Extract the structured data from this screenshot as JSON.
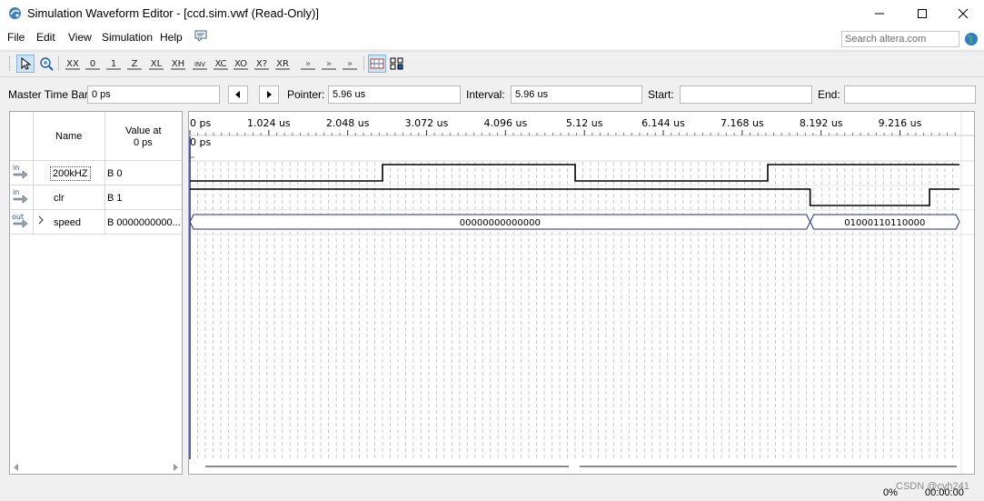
{
  "window": {
    "title": "Simulation Waveform Editor - [ccd.sim.vwf (Read-Only)]"
  },
  "menu": [
    "File",
    "Edit",
    "View",
    "Simulation",
    "Help"
  ],
  "search": {
    "placeholder": "Search altera.com"
  },
  "toolbar_icons": [
    "selection-pointer",
    "zoom",
    "uninitialized",
    "forcing-low",
    "forcing-high",
    "high-impedance",
    "weak-low",
    "weak-high",
    "invert",
    "count-value",
    "clock",
    "arbitrary-value",
    "random-value",
    "snap-to-grid",
    "overwrite-clock",
    "overwrite-value",
    "grid",
    "snap"
  ],
  "timebar": {
    "master_time_bar_label": "Master Time Bar:",
    "master_time_bar_value": "0 ps",
    "pointer_label": "Pointer:",
    "pointer_value": "5.96 us",
    "interval_label": "Interval:",
    "interval_value": "5.96 us",
    "start_label": "Start:",
    "start_value": "",
    "end_label": "End:",
    "end_value": ""
  },
  "columns": {
    "name": "Name",
    "value_line1": "Value at",
    "value_line2": "0 ps"
  },
  "signals": [
    {
      "direction": "in",
      "name": "200kHZ",
      "value": "B 0",
      "expandable": false
    },
    {
      "direction": "in",
      "name": "clr",
      "value": "B 1",
      "expandable": false
    },
    {
      "direction": "out",
      "name": "speed",
      "value": "B 0000000000...",
      "expandable": true
    }
  ],
  "time_ruler": [
    "0 ps",
    "1.024 us",
    "2.048 us",
    "3.072 us",
    "4.096 us",
    "5.12 us",
    "6.144 us",
    "7.168 us",
    "8.192 us",
    "9.216 us"
  ],
  "marker_label": "0 ps",
  "waves": {
    "clk_transitions_us": [
      2.5,
      5.0,
      7.5,
      10.0
    ],
    "clk_initial": 0,
    "clr_low_us": [
      8.05,
      9.6
    ],
    "bus_segments": [
      {
        "start_us": 0,
        "end_us": 8.05,
        "value": "00000000000000"
      },
      {
        "start_us": 8.05,
        "end_us": 10.0,
        "value": "01000110110000"
      }
    ]
  },
  "status": {
    "percent": "0%",
    "time": "00:00:00",
    "watermark": "CSDN @cyh241"
  }
}
